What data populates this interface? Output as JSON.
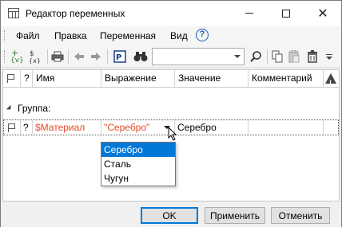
{
  "window": {
    "title": "Редактор переменных"
  },
  "menu": {
    "items": [
      "Файл",
      "Правка",
      "Переменная",
      "Вид"
    ],
    "help": "?"
  },
  "toolbar": {
    "search_value": "",
    "var_label": "{v}"
  },
  "grid": {
    "headers": {
      "flag": "",
      "q": "?",
      "name": "Имя",
      "expression": "Выражение",
      "value": "Значение",
      "comment": "Комментарий"
    },
    "group_label": "Группа:",
    "row": {
      "q": "?",
      "name": "$Материал",
      "expression": "\"Серебро\"",
      "value": "Серебро",
      "comment": ""
    }
  },
  "dropdown": {
    "options": [
      "Серебро",
      "Сталь",
      "Чугун"
    ],
    "selected": "Серебро"
  },
  "buttons": {
    "ok": "OK",
    "apply": "Применить",
    "cancel": "Отменить"
  },
  "colors": {
    "accent": "#0078d7",
    "variable_text": "#e34b26"
  }
}
